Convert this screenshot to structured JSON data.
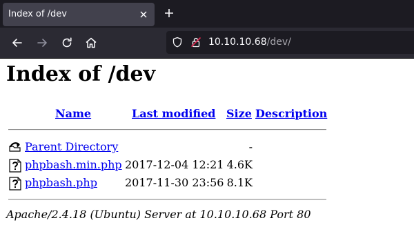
{
  "browser": {
    "tab": {
      "title": "Index of /dev",
      "close_icon": "close-icon"
    },
    "new_tab_icon": "plus-icon",
    "nav": {
      "back_icon": "back-arrow-icon",
      "forward_icon": "forward-arrow-icon",
      "reload_icon": "reload-icon",
      "home_icon": "home-icon"
    },
    "url": {
      "host": "10.10.10.68",
      "path": "/dev/",
      "shield_icon": "shield-icon",
      "insecure_icon": "insecure-lock-icon"
    }
  },
  "page": {
    "title": "Index of /dev",
    "columns": {
      "name": "Name",
      "last_modified": "Last modified",
      "size": "Size",
      "description": "Description"
    },
    "rows": [
      {
        "icon": "parent-directory-icon",
        "name": "Parent Directory",
        "modified": "",
        "size": "-"
      },
      {
        "icon": "unknown-file-icon",
        "name": "phpbash.min.php",
        "modified": "2017-12-04 12:21",
        "size": "4.6K"
      },
      {
        "icon": "unknown-file-icon",
        "name": "phpbash.php",
        "modified": "2017-11-30 23:56",
        "size": "8.1K"
      }
    ],
    "address": "Apache/2.4.18 (Ubuntu) Server at 10.10.10.68 Port 80"
  },
  "colors": {
    "link": "#0000ee",
    "chrome_dark": "#1c1b22",
    "toolbar": "#2b2a33",
    "tab_active": "#42414d",
    "insecure_lock": "#e22850"
  }
}
